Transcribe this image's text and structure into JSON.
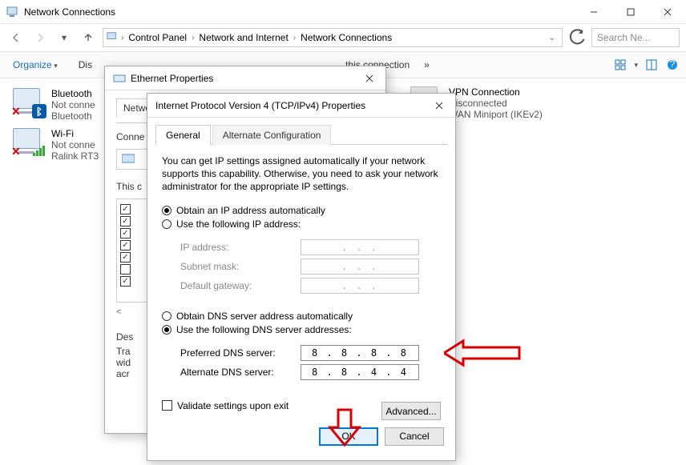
{
  "window": {
    "title": "Network Connections",
    "min_tip": "Minimize",
    "max_tip": "Maximize",
    "close_tip": "Close"
  },
  "breadcrumb": {
    "seg1": "Control Panel",
    "seg2": "Network and Internet",
    "seg3": "Network Connections"
  },
  "search": {
    "placeholder": "Search Ne..."
  },
  "cmdbar": {
    "organize": "Organize",
    "item1": "Dis",
    "item2": "this connection",
    "more": "»"
  },
  "connections": {
    "bt": {
      "name": "Bluetooth",
      "status": "Not conne",
      "device": "Bluetooth"
    },
    "wifi": {
      "name": "Wi-Fi",
      "status": "Not conne",
      "device": "Ralink RT3"
    },
    "vpn": {
      "name": "VPN Connection",
      "status": "Disconnected",
      "device": "WAN Miniport (IKEv2)"
    }
  },
  "eth_dialog": {
    "title": "Ethernet Properties",
    "tab_net": "Netwo",
    "connect_label": "Conne",
    "list_label": "This c",
    "desc_label": "Des",
    "desc_l1": "Tra",
    "desc_l2": "wid",
    "desc_l3": "acr"
  },
  "ipv4": {
    "title": "Internet Protocol Version 4 (TCP/IPv4) Properties",
    "tab_general": "General",
    "tab_alt": "Alternate Configuration",
    "intro": "You can get IP settings assigned automatically if your network supports this capability. Otherwise, you need to ask your network administrator for the appropriate IP settings.",
    "r_ip_auto": "Obtain an IP address automatically",
    "r_ip_manual": "Use the following IP address:",
    "lbl_ip": "IP address:",
    "lbl_mask": "Subnet mask:",
    "lbl_gw": "Default gateway:",
    "r_dns_auto": "Obtain DNS server address automatically",
    "r_dns_manual": "Use the following DNS server addresses:",
    "lbl_pref": "Preferred DNS server:",
    "lbl_alt": "Alternate DNS server:",
    "val_pref": "8 . 8 . 8 . 8",
    "val_alt": "8 . 8 . 4 . 4",
    "dot_placeholder": ".   .   .",
    "validate": "Validate settings upon exit",
    "advanced": "Advanced...",
    "ok": "OK",
    "cancel": "Cancel"
  }
}
